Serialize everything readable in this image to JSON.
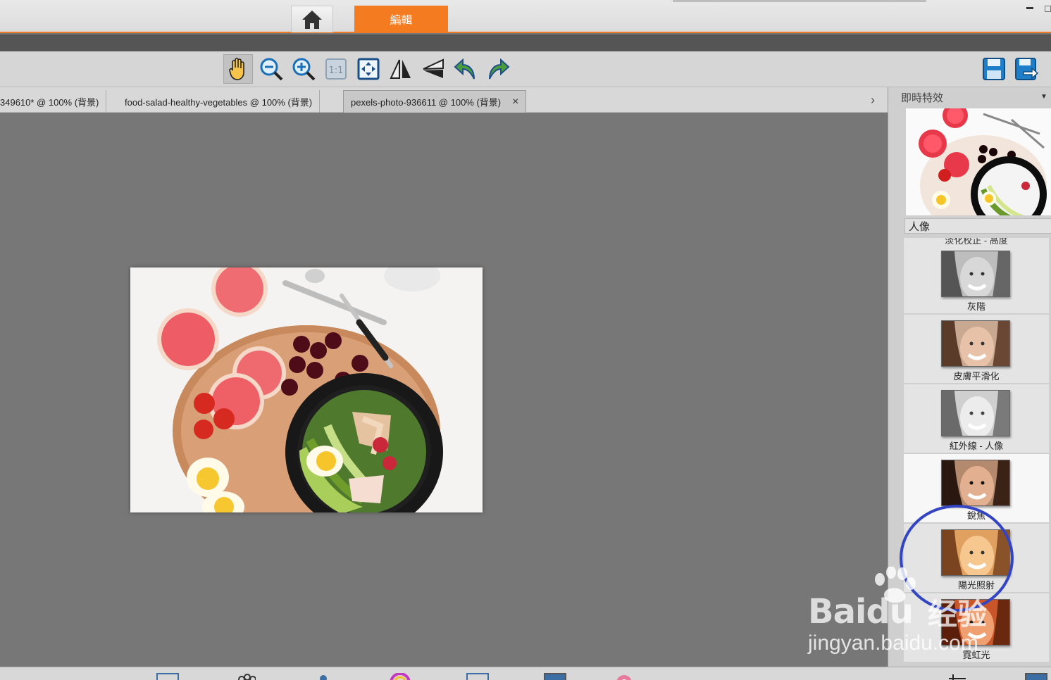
{
  "titlebar": {
    "mode_tab_label": "編輯"
  },
  "doc_tabs": [
    {
      "label": "349610* @ 100% (背景)"
    },
    {
      "label": "food-salad-healthy-vegetables @ 100% (背景)"
    },
    {
      "label": "pexels-photo-936611 @ 100% (背景)",
      "close": "×"
    }
  ],
  "tabs_scroll_glyph": "›",
  "right_panel": {
    "header": "即時特效",
    "category": "人像",
    "cut_label": "淡化校正 - 高度",
    "effects": [
      {
        "label": "灰階"
      },
      {
        "label": "皮膚平滑化"
      },
      {
        "label": "紅外線 - 人像"
      },
      {
        "label": "銳焦"
      },
      {
        "label": "陽光照射"
      },
      {
        "label": "霓虹光"
      }
    ]
  },
  "watermark": {
    "brand": "Bai",
    "brand2": "du",
    "cn": "经验",
    "url": "jingyan.baidu.com"
  },
  "colors": {
    "accent": "#f47b20",
    "annotation_circle": "#3345c2"
  },
  "toolbar_icons": [
    "hand-icon",
    "zoom-out-icon",
    "zoom-in-icon",
    "actual-size-icon",
    "fit-screen-icon",
    "flip-horizontal-icon",
    "flip-vertical-icon",
    "rotate-left-icon",
    "rotate-right-icon",
    "save-icon",
    "save-as-icon"
  ]
}
